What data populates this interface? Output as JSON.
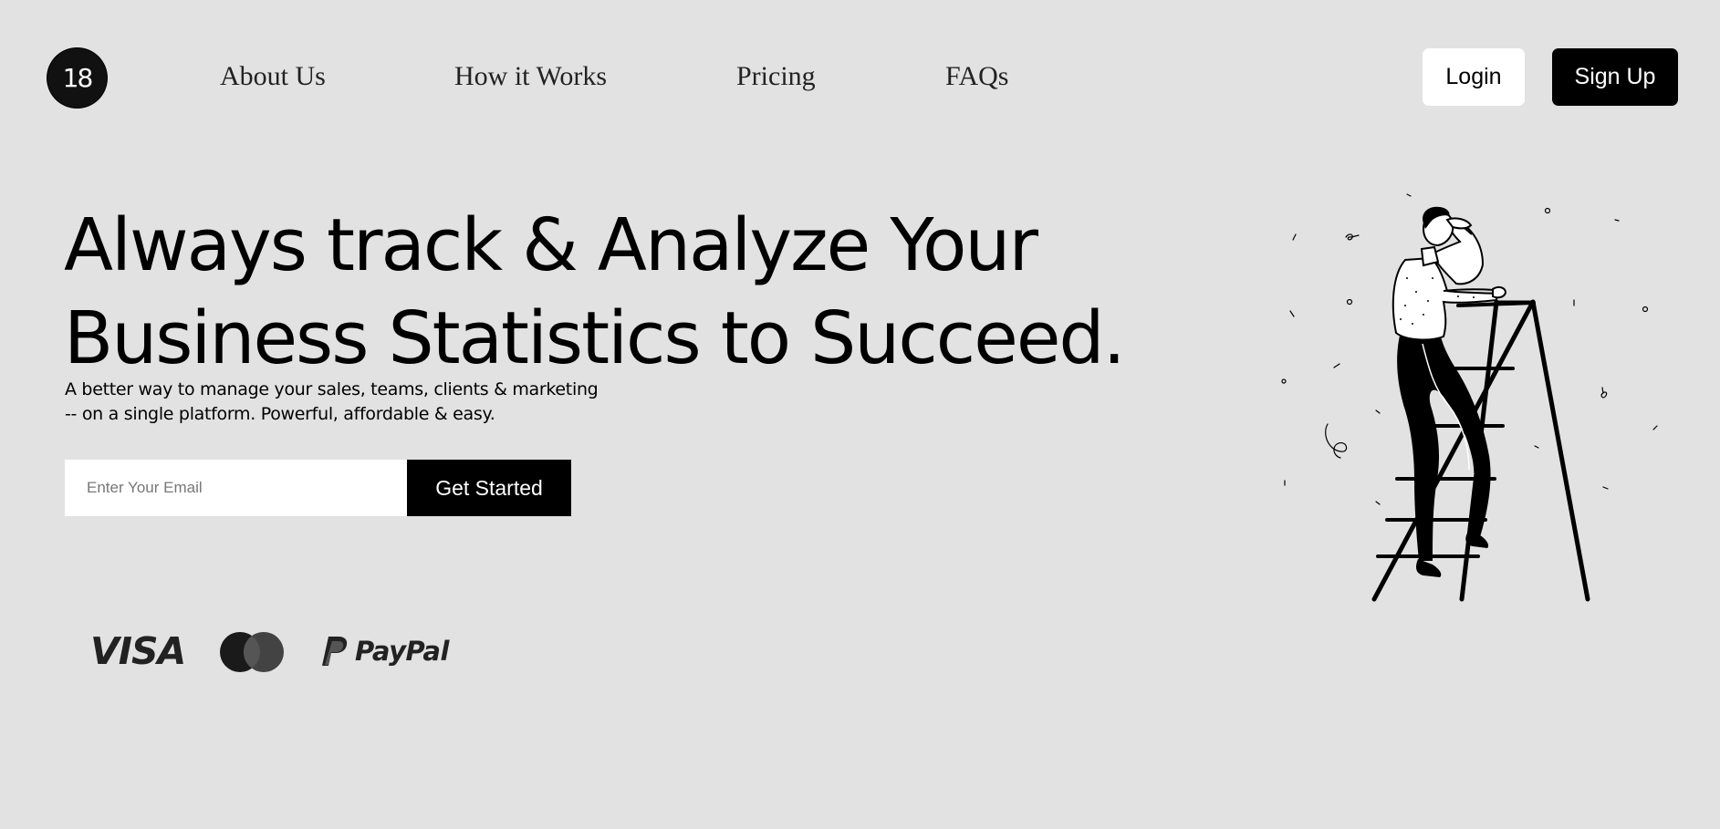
{
  "header": {
    "logo_text": "18",
    "nav": [
      {
        "label": "About Us"
      },
      {
        "label": "How it Works"
      },
      {
        "label": "Pricing"
      },
      {
        "label": "FAQs"
      }
    ],
    "login_label": "Login",
    "signup_label": "Sign Up"
  },
  "hero": {
    "title_line1": "Always track & Analyze Your",
    "title_line2": "Business Statistics to Succeed.",
    "subtitle_line1": "A better way to manage your sales, teams, clients & marketing",
    "subtitle_line2": "-- on a single platform. Powerful, affordable & easy.",
    "email_placeholder": "Enter Your Email",
    "email_value": "",
    "cta_label": "Get Started"
  },
  "payments": {
    "visa_text": "VISA",
    "paypal_text": "PayPal",
    "icons": [
      "visa-logo",
      "mastercard-logo",
      "paypal-logo"
    ]
  },
  "illustration": {
    "icon": "man-on-ladder-illustration"
  },
  "colors": {
    "background": "#e2e2e2",
    "primary": "#000000",
    "button_light": "#ffffff"
  }
}
